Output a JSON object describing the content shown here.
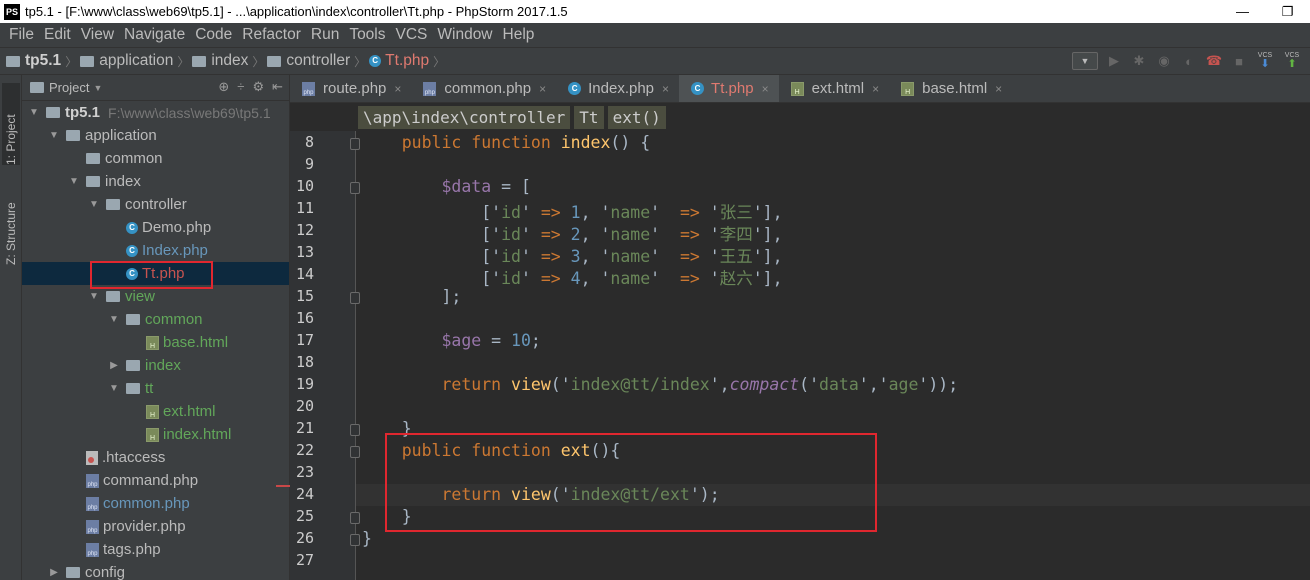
{
  "window": {
    "title": "tp5.1 - [F:\\www\\class\\web69\\tp5.1] - ...\\application\\index\\controller\\Tt.php - PhpStorm 2017.1.5",
    "logo": "PS",
    "minimize_icon": "—",
    "restore_icon": "❐"
  },
  "menu": [
    "File",
    "Edit",
    "View",
    "Navigate",
    "Code",
    "Refactor",
    "Run",
    "Tools",
    "VCS",
    "Window",
    "Help"
  ],
  "navbar": {
    "crumbs": [
      "tp5.1",
      "application",
      "index",
      "controller",
      "Tt.php"
    ],
    "vcs_label": "VCS"
  },
  "toolstrip": {
    "project_tab": "1: Project",
    "structure_tab": "Z: Structure"
  },
  "project_panel": {
    "title": "Project",
    "tree": [
      {
        "label": "tp5.1",
        "hint": "F:\\www\\class\\web69\\tp5.1",
        "depth": 0,
        "arrow": "▼",
        "icon": "folder",
        "style": "bold"
      },
      {
        "label": "application",
        "depth": 1,
        "arrow": "▼",
        "icon": "folder",
        "style": ""
      },
      {
        "label": "common",
        "depth": 2,
        "arrow": "",
        "icon": "folder",
        "style": ""
      },
      {
        "label": "index",
        "depth": 2,
        "arrow": "▼",
        "icon": "folder",
        "style": ""
      },
      {
        "label": "controller",
        "depth": 3,
        "arrow": "▼",
        "icon": "folder",
        "style": ""
      },
      {
        "label": "Demo.php",
        "depth": 4,
        "arrow": "",
        "icon": "class",
        "style": ""
      },
      {
        "label": "Index.php",
        "depth": 4,
        "arrow": "",
        "icon": "class",
        "style": "blue"
      },
      {
        "label": "Tt.php",
        "depth": 4,
        "arrow": "",
        "icon": "class",
        "style": "red",
        "selected": true
      },
      {
        "label": "view",
        "depth": 3,
        "arrow": "▼",
        "icon": "folder",
        "style": "green"
      },
      {
        "label": "common",
        "depth": 4,
        "arrow": "▼",
        "icon": "folder",
        "style": "green"
      },
      {
        "label": "base.html",
        "depth": 5,
        "arrow": "",
        "icon": "html",
        "style": "green"
      },
      {
        "label": "index",
        "depth": 4,
        "arrow": "▶",
        "icon": "folder",
        "style": "green"
      },
      {
        "label": "tt",
        "depth": 4,
        "arrow": "▼",
        "icon": "folder",
        "style": "green"
      },
      {
        "label": "ext.html",
        "depth": 5,
        "arrow": "",
        "icon": "html",
        "style": "green"
      },
      {
        "label": "index.html",
        "depth": 5,
        "arrow": "",
        "icon": "html",
        "style": "green"
      },
      {
        "label": ".htaccess",
        "depth": 2,
        "arrow": "",
        "icon": "htaccess",
        "style": ""
      },
      {
        "label": "command.php",
        "depth": 2,
        "arrow": "",
        "icon": "php",
        "style": ""
      },
      {
        "label": "common.php",
        "depth": 2,
        "arrow": "",
        "icon": "php",
        "style": "blue"
      },
      {
        "label": "provider.php",
        "depth": 2,
        "arrow": "",
        "icon": "php",
        "style": ""
      },
      {
        "label": "tags.php",
        "depth": 2,
        "arrow": "",
        "icon": "php",
        "style": ""
      },
      {
        "label": "config",
        "depth": 1,
        "arrow": "▶",
        "icon": "folder",
        "style": ""
      }
    ]
  },
  "editor": {
    "tabs": [
      {
        "label": "route.php",
        "icon": "php",
        "active": false
      },
      {
        "label": "common.php",
        "icon": "php",
        "active": false
      },
      {
        "label": "Index.php",
        "icon": "class",
        "active": false
      },
      {
        "label": "Tt.php",
        "icon": "class",
        "active": true
      },
      {
        "label": "ext.html",
        "icon": "html",
        "active": false
      },
      {
        "label": "base.html",
        "icon": "html",
        "active": false
      }
    ],
    "breadcrumb": [
      "\\app\\index\\controller",
      "Tt",
      "ext()"
    ],
    "line_numbers": [
      "8",
      "9",
      "10",
      "11",
      "12",
      "13",
      "14",
      "15",
      "16",
      "17",
      "18",
      "19",
      "20",
      "21",
      "22",
      "23",
      "24",
      "25",
      "26",
      "27"
    ],
    "code_lines": [
      [
        {
          "t": "    "
        },
        {
          "t": "public",
          "c": "kw"
        },
        {
          "t": " "
        },
        {
          "t": "function",
          "c": "kw"
        },
        {
          "t": " "
        },
        {
          "t": "index",
          "c": "fn"
        },
        {
          "t": "() {"
        }
      ],
      [],
      [
        {
          "t": "        "
        },
        {
          "t": "$data",
          "c": "var"
        },
        {
          "t": " = ["
        }
      ],
      [
        {
          "t": "            ['"
        },
        {
          "t": "id",
          "c": "str"
        },
        {
          "t": "' "
        },
        {
          "t": "=>",
          "c": "kw"
        },
        {
          "t": " "
        },
        {
          "t": "1",
          "c": "num"
        },
        {
          "t": ", '"
        },
        {
          "t": "name",
          "c": "str"
        },
        {
          "t": "'  "
        },
        {
          "t": "=>",
          "c": "kw"
        },
        {
          "t": " '"
        },
        {
          "t": "张三",
          "c": "str cjk"
        },
        {
          "t": "'],"
        }
      ],
      [
        {
          "t": "            ['"
        },
        {
          "t": "id",
          "c": "str"
        },
        {
          "t": "' "
        },
        {
          "t": "=>",
          "c": "kw"
        },
        {
          "t": " "
        },
        {
          "t": "2",
          "c": "num"
        },
        {
          "t": ", '"
        },
        {
          "t": "name",
          "c": "str"
        },
        {
          "t": "'  "
        },
        {
          "t": "=>",
          "c": "kw"
        },
        {
          "t": " '"
        },
        {
          "t": "李四",
          "c": "str cjk"
        },
        {
          "t": "'],"
        }
      ],
      [
        {
          "t": "            ['"
        },
        {
          "t": "id",
          "c": "str"
        },
        {
          "t": "' "
        },
        {
          "t": "=>",
          "c": "kw"
        },
        {
          "t": " "
        },
        {
          "t": "3",
          "c": "num"
        },
        {
          "t": ", '"
        },
        {
          "t": "name",
          "c": "str"
        },
        {
          "t": "'  "
        },
        {
          "t": "=>",
          "c": "kw"
        },
        {
          "t": " '"
        },
        {
          "t": "王五",
          "c": "str cjk"
        },
        {
          "t": "'],"
        }
      ],
      [
        {
          "t": "            ['"
        },
        {
          "t": "id",
          "c": "str"
        },
        {
          "t": "' "
        },
        {
          "t": "=>",
          "c": "kw"
        },
        {
          "t": " "
        },
        {
          "t": "4",
          "c": "num"
        },
        {
          "t": ", '"
        },
        {
          "t": "name",
          "c": "str"
        },
        {
          "t": "'  "
        },
        {
          "t": "=>",
          "c": "kw"
        },
        {
          "t": " '"
        },
        {
          "t": "赵六",
          "c": "str cjk"
        },
        {
          "t": "'],"
        }
      ],
      [
        {
          "t": "        ];"
        }
      ],
      [],
      [
        {
          "t": "        "
        },
        {
          "t": "$age",
          "c": "var"
        },
        {
          "t": " = "
        },
        {
          "t": "10",
          "c": "num"
        },
        {
          "t": ";"
        }
      ],
      [],
      [
        {
          "t": "        "
        },
        {
          "t": "return",
          "c": "kw"
        },
        {
          "t": " "
        },
        {
          "t": "view",
          "c": "fn"
        },
        {
          "t": "('"
        },
        {
          "t": "index@tt/index",
          "c": "str"
        },
        {
          "t": "',"
        },
        {
          "t": "compact",
          "c": "it"
        },
        {
          "t": "('"
        },
        {
          "t": "data",
          "c": "str"
        },
        {
          "t": "','"
        },
        {
          "t": "age",
          "c": "str"
        },
        {
          "t": "'));"
        }
      ],
      [],
      [
        {
          "t": "    }"
        }
      ],
      [
        {
          "t": "    "
        },
        {
          "t": "public",
          "c": "kw"
        },
        {
          "t": " "
        },
        {
          "t": "function",
          "c": "kw"
        },
        {
          "t": " "
        },
        {
          "t": "ext",
          "c": "fn"
        },
        {
          "t": "(){"
        }
      ],
      [],
      [
        {
          "t": "        "
        },
        {
          "t": "return",
          "c": "kw"
        },
        {
          "t": " "
        },
        {
          "t": "view",
          "c": "fn"
        },
        {
          "t": "('"
        },
        {
          "t": "index@tt/ext",
          "c": "str"
        },
        {
          "t": "');"
        }
      ],
      [
        {
          "t": "    }"
        }
      ],
      [
        {
          "t": "}"
        }
      ],
      []
    ],
    "fold_lines": [
      0,
      2,
      7,
      13,
      14,
      17,
      18
    ]
  }
}
